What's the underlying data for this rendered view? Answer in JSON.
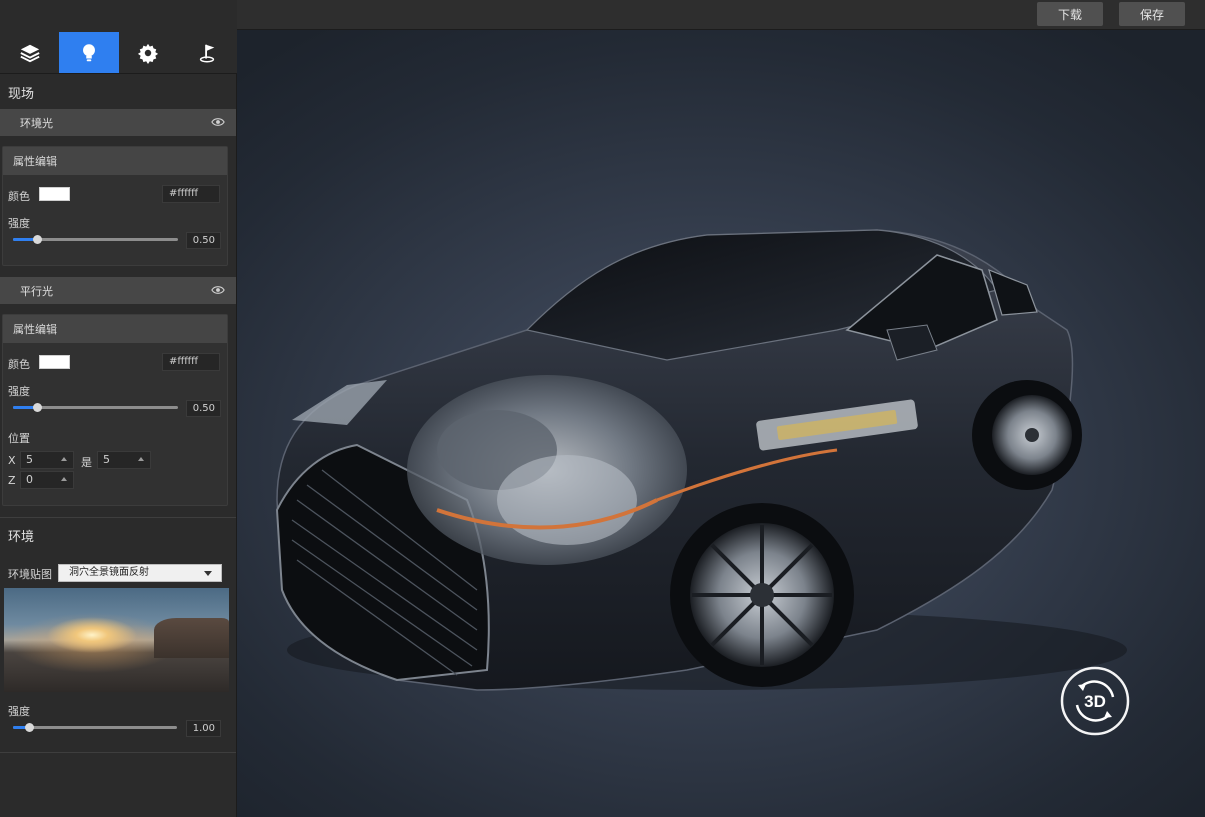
{
  "toolbar": {
    "download_label": "下载",
    "save_label": "保存"
  },
  "tabs": [
    {
      "icon": "layers-icon",
      "active": false
    },
    {
      "icon": "lightbulb-icon",
      "active": true
    },
    {
      "icon": "gear-icon",
      "active": false
    },
    {
      "icon": "flag-icon",
      "active": false
    }
  ],
  "scene": {
    "title": "现场",
    "ambient": {
      "header": "环境光",
      "panel_title": "属性编辑",
      "color_label": "颜色",
      "color_value": "#ffffff",
      "color_hex_text": "#ffffff",
      "intensity_label": "强度",
      "intensity_value": "0.50",
      "intensity_fraction": 0.15
    },
    "directional": {
      "header": "平行光",
      "panel_title": "属性编辑",
      "color_label": "颜色",
      "color_value": "#ffffff",
      "color_hex_text": "#ffffff",
      "intensity_label": "强度",
      "intensity_value": "0.50",
      "intensity_fraction": 0.15,
      "position_label": "位置",
      "x_label": "X",
      "x_value": "5",
      "y_label": "是",
      "y_value": "5",
      "z_label": "Z",
      "z_value": "0"
    }
  },
  "environment": {
    "title": "环境",
    "map_label": "环境贴图",
    "map_selected": "洞穴全景镜面反射",
    "intensity_label": "强度",
    "intensity_value": "1.00",
    "intensity_fraction": 0.1
  },
  "viewport": {
    "badge_text": "3D"
  },
  "colors": {
    "accent": "#2f7ff0"
  }
}
